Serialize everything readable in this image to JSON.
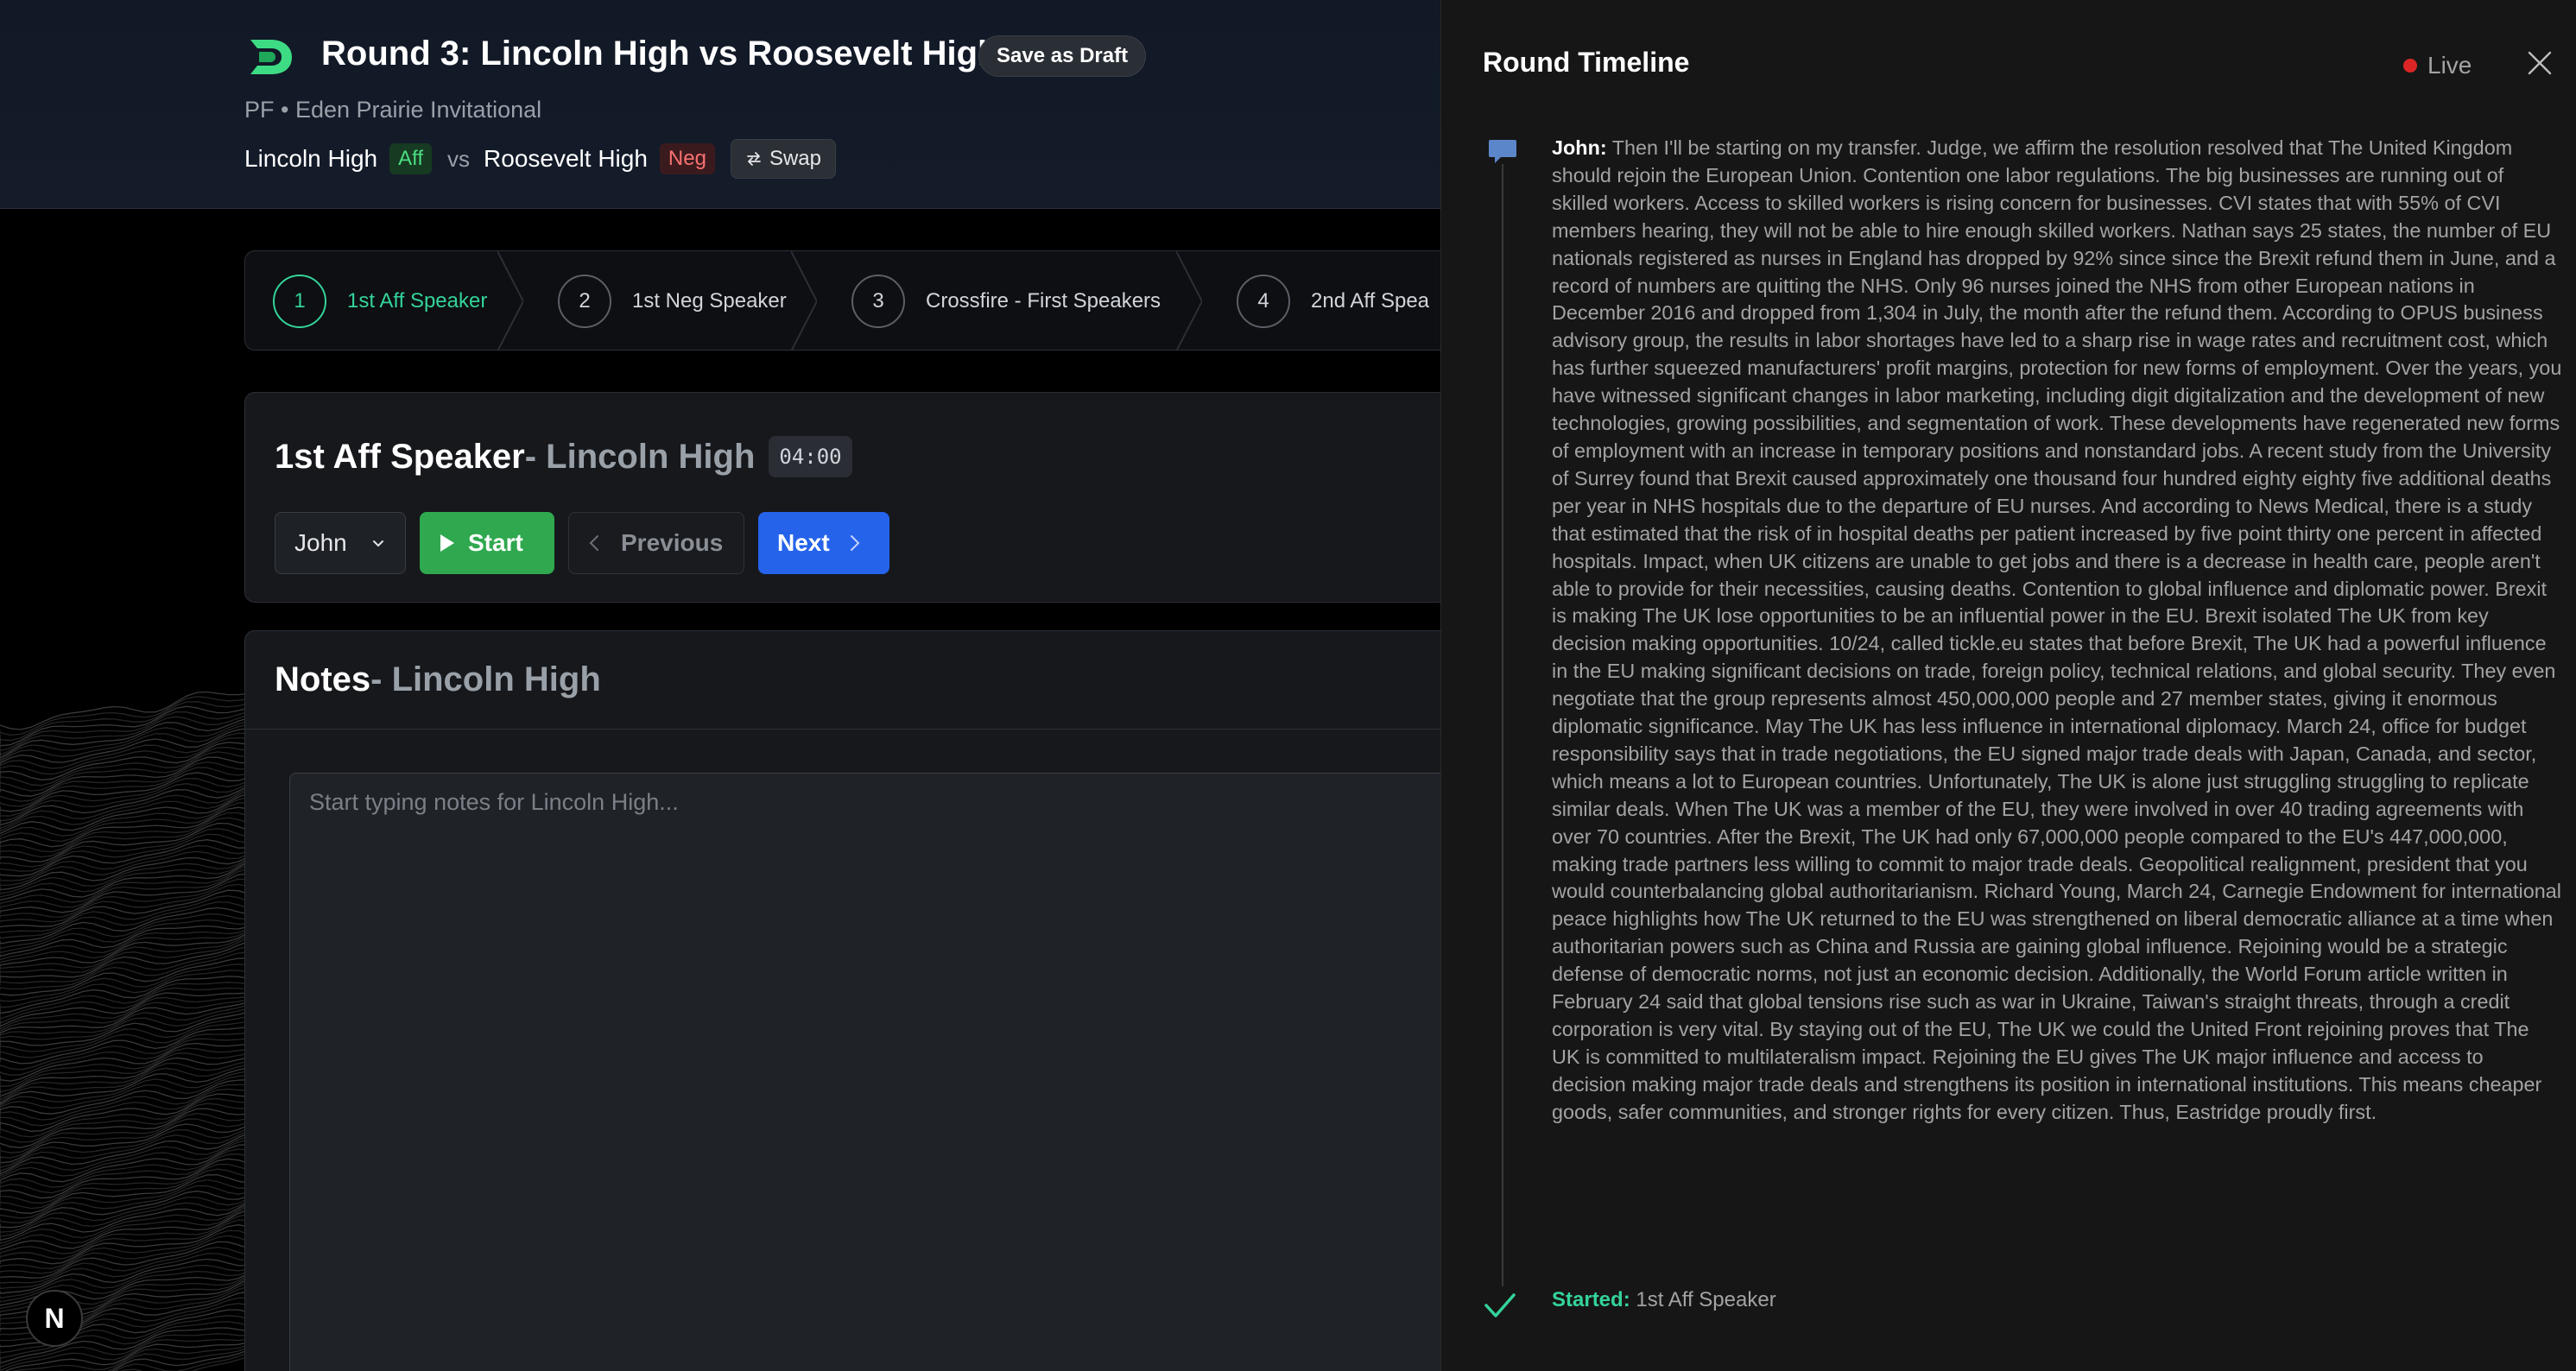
{
  "header": {
    "title": "Round 3: Lincoln High vs Roosevelt High",
    "save_draft": "Save as Draft",
    "subtitle": "PF • Eden Prairie Invitational",
    "aff_team": "Lincoln High",
    "aff_badge": "Aff",
    "vs": "vs",
    "neg_team": "Roosevelt High",
    "neg_badge": "Neg",
    "swap": "Swap"
  },
  "steps": [
    {
      "num": "1",
      "label": "1st Aff Speaker",
      "active": true
    },
    {
      "num": "2",
      "label": "1st Neg Speaker",
      "active": false
    },
    {
      "num": "3",
      "label": "Crossfire - First Speakers",
      "active": false
    },
    {
      "num": "4",
      "label": "2nd Aff Spea",
      "active": false
    }
  ],
  "speaker": {
    "role": "1st Aff Speaker",
    "team_suffix": " - Lincoln High",
    "timer": "04:00",
    "selected_speaker": "John",
    "start": "Start",
    "previous": "Previous",
    "next": "Next"
  },
  "notes": {
    "title": "Notes",
    "team_suffix": " - Lincoln High",
    "placeholder": "Start typing notes for Lincoln High..."
  },
  "timeline": {
    "title": "Round Timeline",
    "live": "Live",
    "entry_speaker": "John:",
    "entry_text": " Then I'll be starting on my transfer. Judge, we affirm the resolution resolved that The United Kingdom should rejoin the European Union. Contention one labor regulations. The big businesses are running out of skilled workers. Access to skilled workers is rising concern for businesses. CVI states that with 55% of CVI members hearing, they will not be able to hire enough skilled workers. Nathan says 25 states, the number of EU nationals registered as nurses in England has dropped by 92% since since the Brexit refund them in June, and a record of numbers are quitting the NHS. Only 96 nurses joined the NHS from other European nations in December 2016 and dropped from 1,304 in July, the month after the refund them. According to OPUS business advisory group, the results in labor shortages have led to a sharp rise in wage rates and recruitment cost, which has further squeezed manufacturers' profit margins, protection for new forms of employment. Over the years, you have witnessed significant changes in labor marketing, including digit digitalization and the development of new technologies, growing possibilities, and segmentation of work. These developments have regenerated new forms of employment with an increase in temporary positions and nonstandard jobs. A recent study from the University of Surrey found that Brexit caused approximately one thousand four hundred eighty eighty five additional deaths per year in NHS hospitals due to the departure of EU nurses. And according to News Medical, there is a study that estimated that the risk of in hospital deaths per patient increased by five point thirty one percent in affected hospitals. Impact, when UK citizens are unable to get jobs and there is a decrease in health care, people aren't able to provide for their necessities, causing deaths. Contention to global influence and diplomatic power. Brexit is making The UK lose opportunities to be an influential power in the EU. Brexit isolated The UK from key decision making opportunities. 10/24, called tickle.eu states that before Brexit, The UK had a powerful influence in the EU making significant decisions on trade, foreign policy, technical relations, and global security. They even negotiate that the group represents almost 450,000,000 people and 27 member states, giving it enormous diplomatic significance. May The UK has less influence in international diplomacy. March 24, office for budget responsibility says that in trade negotiations, the EU signed major trade deals with Japan, Canada, and sector, which means a lot to European countries. Unfortunately, The UK is alone just struggling struggling to replicate similar deals. When The UK was a member of the EU, they were involved in over 40 trading agreements with over 70 countries. After the Brexit, The UK had only 67,000,000 people compared to the EU's 447,000,000, making trade partners less willing to commit to major trade deals. Geopolitical realignment, president that you would counterbalancing global authoritarianism. Richard Young, March 24, Carnegie Endowment for international peace highlights how The UK returned to the EU was strengthened on liberal democratic alliance at a time when authoritarian powers such as China and Russia are gaining global influence. Rejoining would be a strategic defense of democratic norms, not just an economic decision. Additionally, the World Forum article written in February 24 said that global tensions rise such as war in Ukraine, Taiwan's straight threats, through a credit corporation is very vital. By staying out of the EU, The UK we could the United Front rejoining proves that The UK is committed to multilateralism impact. Rejoining the EU gives The UK major influence and access to decision making major trade deals and strengthens its position in international institutions. This means cheaper goods, safer communities, and stronger rights for every citizen. Thus, Eastridge proudly first.",
    "started_label": "Started:",
    "started_value": " 1st Aff Speaker"
  },
  "colors": {
    "accent_green": "#34d399",
    "start_green": "#2fa84f",
    "next_blue": "#2563eb",
    "live_red": "#dc2626"
  },
  "icons": [
    "logo-icon",
    "swap-icon",
    "chevron-down-icon",
    "play-icon",
    "chevron-left-icon",
    "chevron-right-icon",
    "close-icon",
    "chat-bubble-icon",
    "checkmark-icon"
  ],
  "dev_badge": "N"
}
